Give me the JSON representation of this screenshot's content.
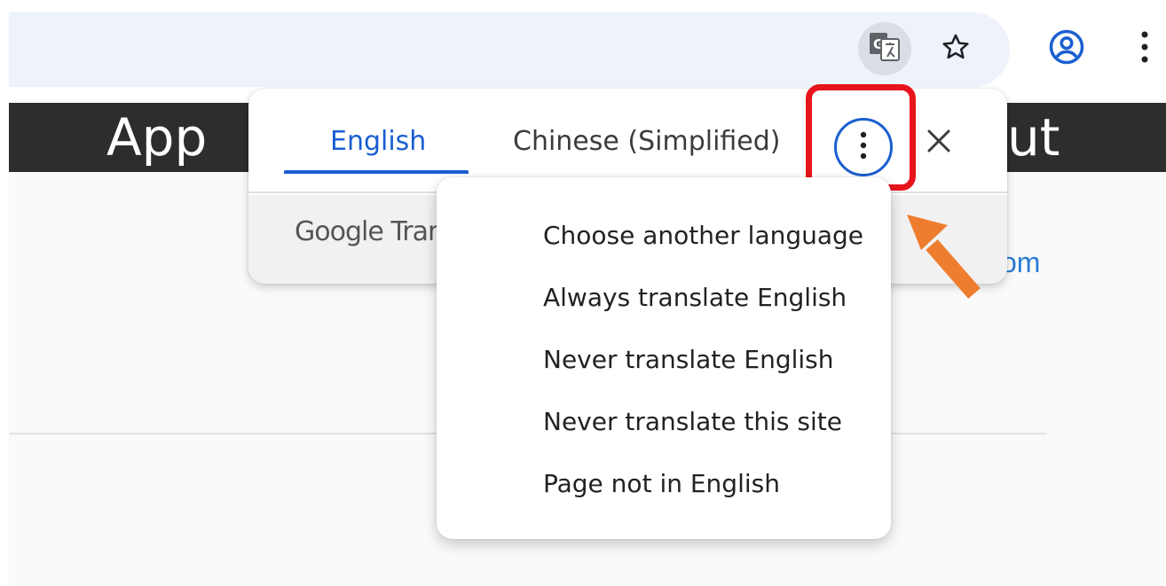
{
  "toolbar": {
    "icons": [
      "translate-icon",
      "bookmark-star-icon",
      "profile-icon",
      "more-vert-icon"
    ]
  },
  "page": {
    "header_left": "App",
    "header_right": "ut",
    "link_fragment": "om"
  },
  "translate_bubble": {
    "tabs": [
      {
        "label": "English",
        "selected": true
      },
      {
        "label": "Chinese (Simplified)",
        "selected": false
      }
    ],
    "footer_text": "Google Tran",
    "accent_color": "#1a5fd0"
  },
  "options_menu": {
    "items": [
      {
        "label": "Choose another language"
      },
      {
        "label": "Always translate English"
      },
      {
        "label": "Never translate English"
      },
      {
        "label": "Never translate this site"
      },
      {
        "label": "Page not in English"
      }
    ]
  },
  "annotations": {
    "highlight_color": "#e8141c",
    "arrow_color": "#ee7d2f"
  }
}
